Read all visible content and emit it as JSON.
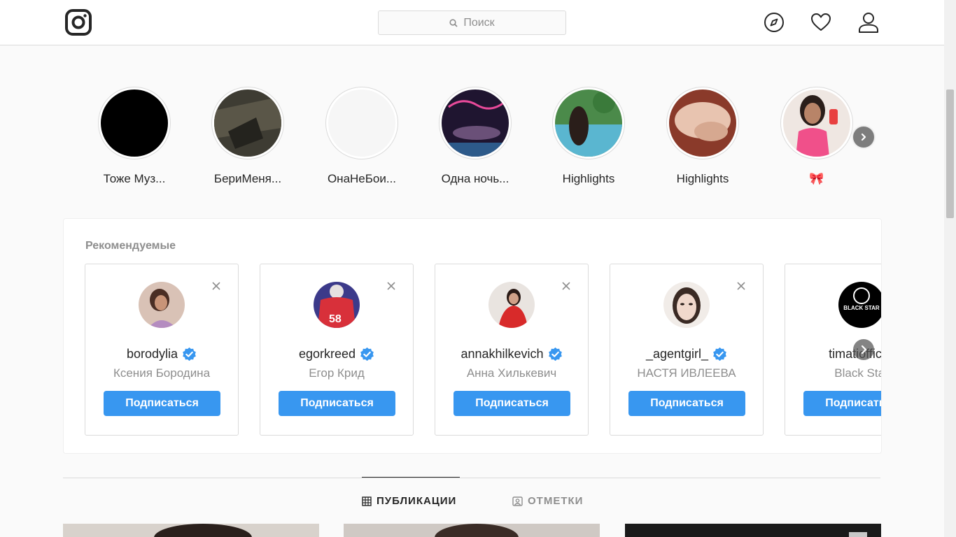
{
  "header": {
    "search_placeholder": "Поиск",
    "icons": [
      "instagram-logo",
      "compass-icon",
      "heart-icon",
      "profile-icon"
    ]
  },
  "stories": [
    {
      "label": "Тоже Муз...",
      "color": "#000000"
    },
    {
      "label": "БериМеня...",
      "color": "#3e3c33"
    },
    {
      "label": "ОнаНеБои...",
      "color": "#f5f5f5"
    },
    {
      "label": "Одна ночь...",
      "color": "#2a1a3a"
    },
    {
      "label": "Highlights",
      "color": "#5aa6c0"
    },
    {
      "label": "Highlights",
      "color": "#c47a60"
    },
    {
      "label": "🎀",
      "color": "#e45a90"
    }
  ],
  "suggested": {
    "title": "Рекомендуемые",
    "follow_label": "Подписаться",
    "cards": [
      {
        "username": "borodylia",
        "name": "Ксения Бородина",
        "avatar_color": "#b8948a"
      },
      {
        "username": "egorkreed",
        "name": "Егор Крид",
        "avatar_color": "#c0303a"
      },
      {
        "username": "annakhilkevich",
        "name": "Анна Хилькевич",
        "avatar_color": "#d83838"
      },
      {
        "username": "_agentgirl_",
        "name": "НАСТЯ ИВЛЕЕВА",
        "avatar_color": "#e8dcd6"
      },
      {
        "username": "timatiofficial",
        "name": "Black Star",
        "avatar_color": "#000000"
      }
    ]
  },
  "tabs": {
    "posts": "ПУБЛИКАЦИИ",
    "tagged": "ОТМЕТКИ"
  },
  "colors": {
    "accent": "#3897f0",
    "verified": "#3897f0",
    "muted": "#8e8e8e",
    "border": "#dbdbdb"
  }
}
